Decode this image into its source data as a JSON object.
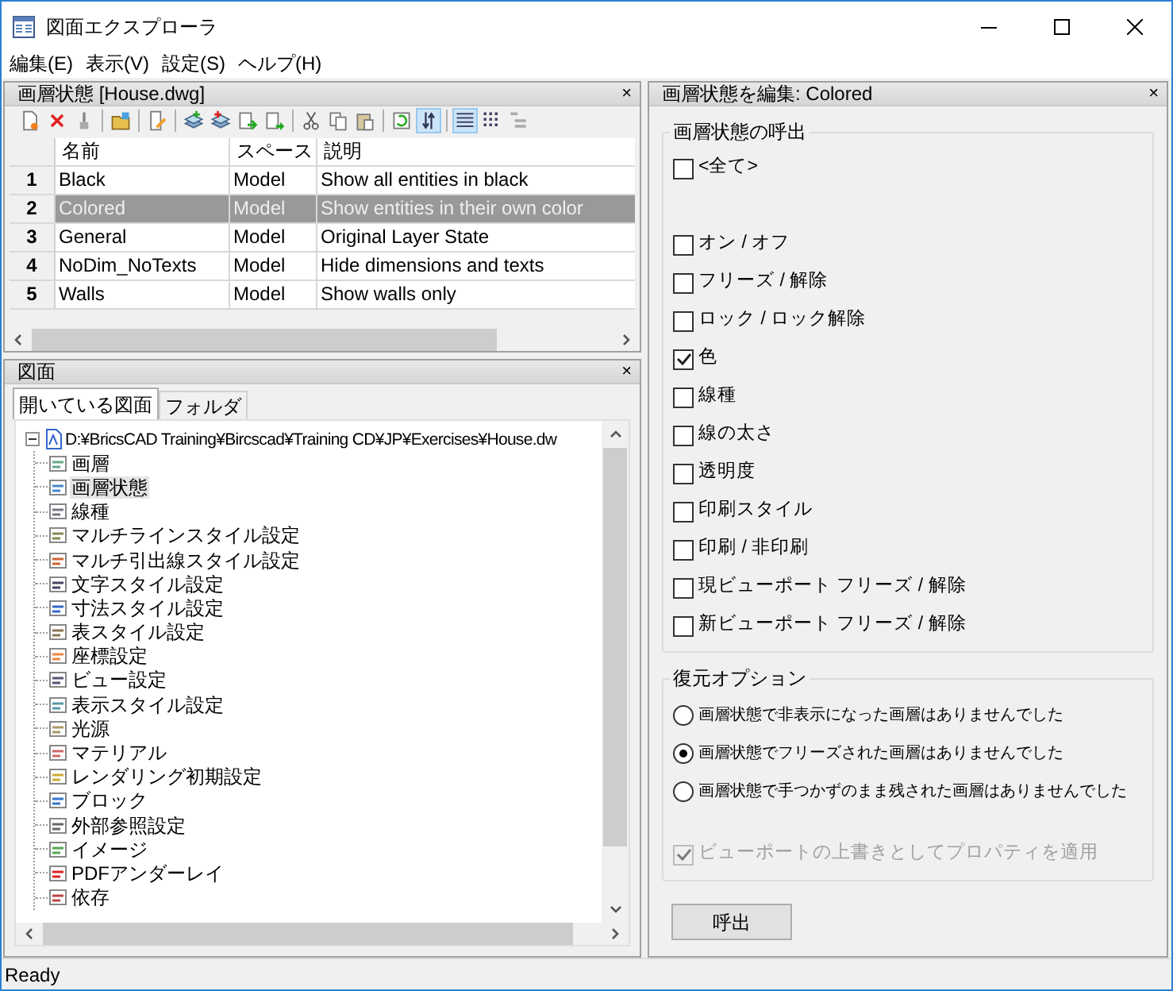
{
  "window": {
    "title": "図面エクスプローラ"
  },
  "menu": [
    "編集(E)",
    "表示(V)",
    "設定(S)",
    "ヘルプ(H)"
  ],
  "layer_states_panel": {
    "title": "画層状態 [House.dwg]",
    "close": "×",
    "toolbar": [
      {
        "pressed": false
      },
      {
        "pressed": false
      },
      {
        "pressed": false
      },
      {
        "pressed": false
      },
      {
        "pressed": false
      },
      {
        "pressed": false
      },
      {
        "pressed": false
      },
      {
        "pressed": false
      },
      {
        "pressed": false
      },
      {
        "pressed": false
      },
      {
        "pressed": false
      },
      {
        "pressed": false
      },
      {
        "pressed": false
      },
      {
        "pressed": true
      },
      {
        "pressed": true
      },
      {
        "pressed": false
      },
      {
        "pressed": false
      }
    ],
    "table": {
      "columns": [
        "名前",
        "スペース",
        "説明"
      ],
      "rows": [
        {
          "index": "1",
          "cells": [
            "Black",
            "Model",
            "Show all entities in black"
          ],
          "selected": false
        },
        {
          "index": "2",
          "cells": [
            "Colored",
            "Model",
            "Show entities in their own color"
          ],
          "selected": true
        },
        {
          "index": "3",
          "cells": [
            "General",
            "Model",
            "Original Layer State"
          ],
          "selected": false
        },
        {
          "index": "4",
          "cells": [
            "NoDim_NoTexts",
            "Model",
            "Hide dimensions and texts"
          ],
          "selected": false
        },
        {
          "index": "5",
          "cells": [
            "Walls",
            "Model",
            "Show walls only"
          ],
          "selected": false
        }
      ]
    }
  },
  "drawings_panel": {
    "title": "図面",
    "close": "×",
    "tabs": [
      {
        "label": "開いている図面",
        "selected": true
      },
      {
        "label": "フォルダ",
        "selected": false
      }
    ],
    "tree": [
      {
        "label": "D:¥BricsCAD Training¥Bircscad¥Training CD¥JP¥Exercises¥House.dw",
        "expanded": true,
        "selected": false,
        "children": [
          {
            "label": "画層",
            "selected": false
          },
          {
            "label": "画層状態",
            "selected": true
          },
          {
            "label": "線種",
            "selected": false
          },
          {
            "label": "マルチラインスタイル設定",
            "selected": false
          },
          {
            "label": "マルチ引出線スタイル設定",
            "selected": false
          },
          {
            "label": "文字スタイル設定",
            "selected": false
          },
          {
            "label": "寸法スタイル設定",
            "selected": false
          },
          {
            "label": "表スタイル設定",
            "selected": false
          },
          {
            "label": "座標設定",
            "selected": false
          },
          {
            "label": "ビュー設定",
            "selected": false
          },
          {
            "label": "表示スタイル設定",
            "selected": false
          },
          {
            "label": "光源",
            "selected": false
          },
          {
            "label": "マテリアル",
            "selected": false
          },
          {
            "label": "レンダリング初期設定",
            "selected": false
          },
          {
            "label": "ブロック",
            "selected": false
          },
          {
            "label": "外部参照設定",
            "selected": false
          },
          {
            "label": "イメージ",
            "selected": false
          },
          {
            "label": "PDFアンダーレイ",
            "selected": false
          },
          {
            "label": "依存",
            "selected": false
          }
        ]
      }
    ]
  },
  "edit_panel": {
    "title": "画層状態を編集: Colored",
    "close": "×",
    "recall_group": {
      "title": "画層状態の呼出",
      "options": [
        {
          "label": "<全て>",
          "checked": false
        },
        {
          "label": "オン / オフ",
          "checked": false
        },
        {
          "label": "フリーズ / 解除",
          "checked": false
        },
        {
          "label": "ロック / ロック解除",
          "checked": false
        },
        {
          "label": "色",
          "checked": true
        },
        {
          "label": "線種",
          "checked": false
        },
        {
          "label": "線の太さ",
          "checked": false
        },
        {
          "label": "透明度",
          "checked": false
        },
        {
          "label": "印刷スタイル",
          "checked": false
        },
        {
          "label": "印刷 / 非印刷",
          "checked": false
        },
        {
          "label": "現ビューポート フリーズ / 解除",
          "checked": false
        },
        {
          "label": "新ビューポート フリーズ / 解除",
          "checked": false
        }
      ]
    },
    "restore_group": {
      "title": "復元オプション",
      "options": [
        {
          "label": "画層状態で非表示になった画層はありませんでした",
          "selected": false
        },
        {
          "label": "画層状態でフリーズされた画層はありませんでした",
          "selected": true
        },
        {
          "label": "画層状態で手つかずのまま残された画層はありませんでした",
          "selected": false
        }
      ],
      "viewport_override": {
        "label": "ビューポートの上書きとしてプロパティを適用",
        "checked": true,
        "disabled": true
      }
    },
    "recall_button": "呼出"
  },
  "status_bar": "Ready"
}
